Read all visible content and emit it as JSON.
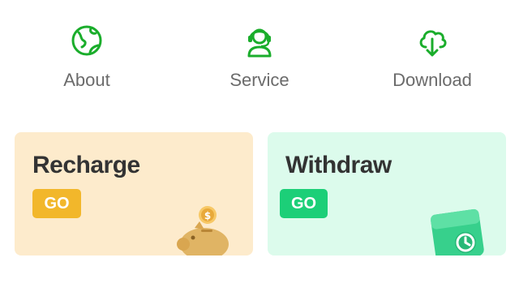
{
  "nav": {
    "items": [
      {
        "label": "About",
        "icon": "globe-icon"
      },
      {
        "label": "Service",
        "icon": "headset-agent-icon"
      },
      {
        "label": "Download",
        "icon": "cloud-download-icon"
      }
    ]
  },
  "cards": {
    "recharge": {
      "title": "Recharge",
      "button": "GO",
      "icon": "piggy-bank-coin-icon"
    },
    "withdraw": {
      "title": "Withdraw",
      "button": "GO",
      "icon": "wallet-clock-icon"
    }
  },
  "colors": {
    "accent_green": "#1aad2b",
    "recharge_bg": "#fdebcc",
    "recharge_button": "#f2b72b",
    "withdraw_bg": "#dcfbec",
    "withdraw_button": "#1ccf78"
  }
}
